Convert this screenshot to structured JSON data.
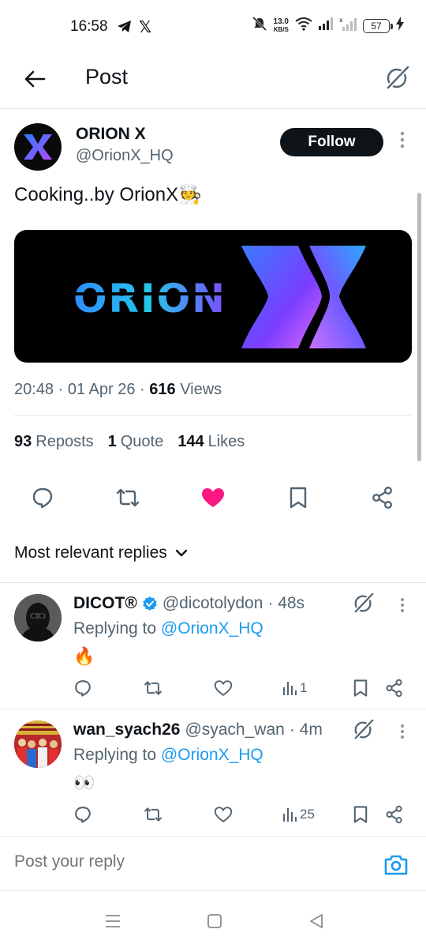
{
  "status_bar": {
    "time": "16:58",
    "x_label": "𝕏",
    "net_speed_top": "13.0",
    "net_speed_bottom": "KB/S",
    "battery": "57"
  },
  "header": {
    "title": "Post"
  },
  "post": {
    "author_name": "ORION X",
    "author_handle": "@OrionX_HQ",
    "follow_label": "Follow",
    "text": "Cooking..by OrionX🧑‍🍳",
    "time": "20:48",
    "date": "01 Apr 26",
    "views_count": "616",
    "views_label": "Views",
    "reposts_count": "93",
    "reposts_label": "Reposts",
    "quotes_count": "1",
    "quotes_label": "Quote",
    "likes_count": "144",
    "likes_label": "Likes",
    "image_wordmark": "ORION",
    "liked": true
  },
  "replies_sort": {
    "label": "Most relevant replies"
  },
  "replies": [
    {
      "name": "DICOT®",
      "verified": true,
      "handle": "@dicotolydon",
      "age": "· 48s",
      "replying_prefix": "Replying to",
      "replying_to": "@OrionX_HQ",
      "body": "🔥",
      "views": "1"
    },
    {
      "name": "wan_syach26",
      "verified": false,
      "handle": "@syach_wan",
      "age": "· 4m",
      "replying_prefix": "Replying to",
      "replying_to": "@OrionX_HQ",
      "body": "👀",
      "views": "25"
    }
  ],
  "composer": {
    "placeholder": "Post your reply"
  },
  "colors": {
    "like_pink": "#f91880",
    "link_blue": "#1d9bf0",
    "text_secondary": "#536471"
  }
}
